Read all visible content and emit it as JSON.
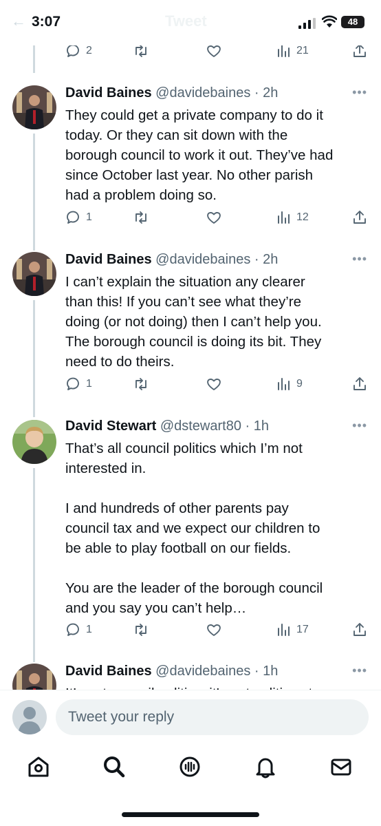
{
  "status": {
    "time": "3:07",
    "battery": "48",
    "header_title": "Tweet"
  },
  "top_actions": {
    "replies": "2",
    "views": "21"
  },
  "tweets": [
    {
      "name": "David Baines",
      "handle": "@davidebaines",
      "age": "2h",
      "text": "They could get a private company to do it\ntoday. Or they can sit down with the\nborough council to work it out. They’ve had\nsince October last year. No other parish\nhad a problem doing so.",
      "replies": "1",
      "views": "12"
    },
    {
      "name": "David Baines",
      "handle": "@davidebaines",
      "age": "2h",
      "text": "I can’t explain the situation any clearer\nthan this! If you can’t see what they’re\ndoing (or not doing) then I can’t help you.\nThe borough council is doing its bit. They\nneed to do theirs.",
      "replies": "1",
      "views": "9"
    },
    {
      "name": "David Stewart",
      "handle": "@dstewart80",
      "age": "1h",
      "text": "That’s all council politics which I’m not\ninterested in.\n\nI and hundreds of other parents pay\ncouncil tax and we expect our children to\nbe able to play football on our fields.\n\nYou are the leader of the borough council\nand you say you can’t help…",
      "replies": "1",
      "views": "17"
    },
    {
      "name": "David Baines",
      "handle": "@davidebaines",
      "age": "1h",
      "text": "It’s not council politics, it’s not politics at"
    }
  ],
  "reply": {
    "placeholder": "Tweet your reply"
  },
  "nav": [
    "home-icon",
    "search-icon",
    "spaces-icon",
    "notifications-icon",
    "messages-icon"
  ]
}
